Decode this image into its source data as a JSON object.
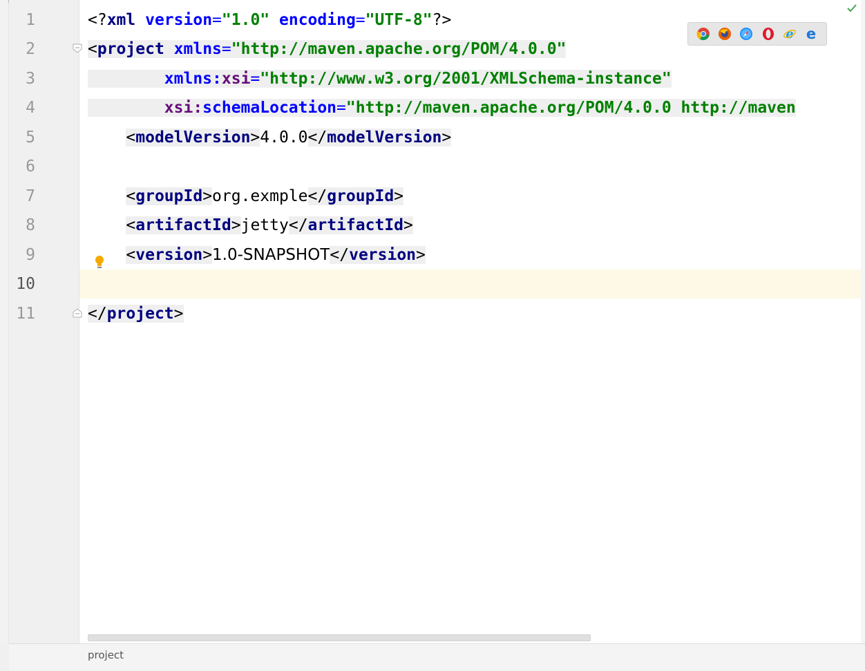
{
  "editor": {
    "line_numbers": [
      "1",
      "2",
      "3",
      "4",
      "5",
      "6",
      "7",
      "8",
      "9",
      "10",
      "11"
    ],
    "current_line": "10",
    "lines": {
      "l1": {
        "open": "<?",
        "name": "xml",
        "a1": "version",
        "eq1": "=",
        "v1": "\"1.0\"",
        "a2": "encoding",
        "eq2": "=",
        "v2": "\"UTF-8\"",
        "close": "?>"
      },
      "l2": {
        "open": "<",
        "name": "project",
        "attr": "xmlns",
        "eq": "=",
        "val": "\"http://maven.apache.org/POM/4.0.0\""
      },
      "l3": {
        "ns": "xmlns:",
        "attr": "xsi",
        "eq": "=",
        "val": "\"http://www.w3.org/2001/XMLSchema-instance\""
      },
      "l4": {
        "ns": "xsi:",
        "attr": "schemaLocation",
        "eq": "=",
        "val": "\"http://maven.apache.org/POM/4.0.0 http://maven"
      },
      "l5": {
        "lt": "<",
        "name": "modelVersion",
        "gt": ">",
        "text": "4.0.0",
        "lt2": "</",
        "name2": "modelVersion",
        "gt2": ">"
      },
      "l7": {
        "lt": "<",
        "name": "groupId",
        "gt": ">",
        "text": "org.exmple",
        "lt2": "</",
        "name2": "groupId",
        "gt2": ">"
      },
      "l8": {
        "lt": "<",
        "name": "artifactId",
        "gt": ">",
        "text": "jetty",
        "lt2": "</",
        "name2": "artifactId",
        "gt2": ">"
      },
      "l9": {
        "lt": "<",
        "name": "version",
        "gt": ">",
        "text": "1.0-SNAPSHOT",
        "lt2": "</",
        "name2": "version",
        "gt2": ">"
      },
      "l11": {
        "lt": "</",
        "name": "project",
        "gt": ">"
      }
    }
  },
  "browser_toolbar": {
    "icons": [
      "chrome-icon",
      "firefox-icon",
      "safari-icon",
      "opera-icon",
      "internet-explorer-icon",
      "edge-icon"
    ]
  },
  "status_bar": {
    "breadcrumb": "project"
  },
  "colors": {
    "tag": "#000080",
    "attribute": "#0000ff",
    "namespace": "#660e7a",
    "string": "#008000",
    "caret_row": "#fdf9e6",
    "gutter": "#f0f0f0"
  }
}
